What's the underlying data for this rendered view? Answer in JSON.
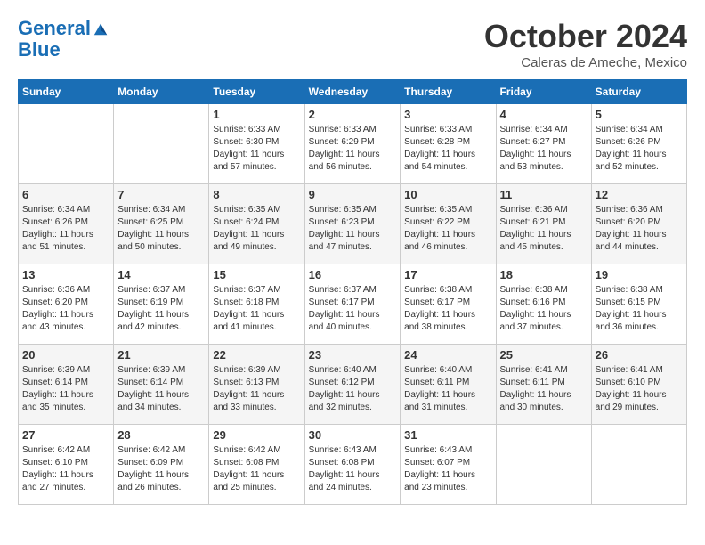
{
  "header": {
    "logo_line1": "General",
    "logo_line2": "Blue",
    "month": "October 2024",
    "location": "Caleras de Ameche, Mexico"
  },
  "days_of_week": [
    "Sunday",
    "Monday",
    "Tuesday",
    "Wednesday",
    "Thursday",
    "Friday",
    "Saturday"
  ],
  "weeks": [
    [
      {
        "day": "",
        "info": ""
      },
      {
        "day": "",
        "info": ""
      },
      {
        "day": "1",
        "info": "Sunrise: 6:33 AM\nSunset: 6:30 PM\nDaylight: 11 hours and 57 minutes."
      },
      {
        "day": "2",
        "info": "Sunrise: 6:33 AM\nSunset: 6:29 PM\nDaylight: 11 hours and 56 minutes."
      },
      {
        "day": "3",
        "info": "Sunrise: 6:33 AM\nSunset: 6:28 PM\nDaylight: 11 hours and 54 minutes."
      },
      {
        "day": "4",
        "info": "Sunrise: 6:34 AM\nSunset: 6:27 PM\nDaylight: 11 hours and 53 minutes."
      },
      {
        "day": "5",
        "info": "Sunrise: 6:34 AM\nSunset: 6:26 PM\nDaylight: 11 hours and 52 minutes."
      }
    ],
    [
      {
        "day": "6",
        "info": "Sunrise: 6:34 AM\nSunset: 6:26 PM\nDaylight: 11 hours and 51 minutes."
      },
      {
        "day": "7",
        "info": "Sunrise: 6:34 AM\nSunset: 6:25 PM\nDaylight: 11 hours and 50 minutes."
      },
      {
        "day": "8",
        "info": "Sunrise: 6:35 AM\nSunset: 6:24 PM\nDaylight: 11 hours and 49 minutes."
      },
      {
        "day": "9",
        "info": "Sunrise: 6:35 AM\nSunset: 6:23 PM\nDaylight: 11 hours and 47 minutes."
      },
      {
        "day": "10",
        "info": "Sunrise: 6:35 AM\nSunset: 6:22 PM\nDaylight: 11 hours and 46 minutes."
      },
      {
        "day": "11",
        "info": "Sunrise: 6:36 AM\nSunset: 6:21 PM\nDaylight: 11 hours and 45 minutes."
      },
      {
        "day": "12",
        "info": "Sunrise: 6:36 AM\nSunset: 6:20 PM\nDaylight: 11 hours and 44 minutes."
      }
    ],
    [
      {
        "day": "13",
        "info": "Sunrise: 6:36 AM\nSunset: 6:20 PM\nDaylight: 11 hours and 43 minutes."
      },
      {
        "day": "14",
        "info": "Sunrise: 6:37 AM\nSunset: 6:19 PM\nDaylight: 11 hours and 42 minutes."
      },
      {
        "day": "15",
        "info": "Sunrise: 6:37 AM\nSunset: 6:18 PM\nDaylight: 11 hours and 41 minutes."
      },
      {
        "day": "16",
        "info": "Sunrise: 6:37 AM\nSunset: 6:17 PM\nDaylight: 11 hours and 40 minutes."
      },
      {
        "day": "17",
        "info": "Sunrise: 6:38 AM\nSunset: 6:17 PM\nDaylight: 11 hours and 38 minutes."
      },
      {
        "day": "18",
        "info": "Sunrise: 6:38 AM\nSunset: 6:16 PM\nDaylight: 11 hours and 37 minutes."
      },
      {
        "day": "19",
        "info": "Sunrise: 6:38 AM\nSunset: 6:15 PM\nDaylight: 11 hours and 36 minutes."
      }
    ],
    [
      {
        "day": "20",
        "info": "Sunrise: 6:39 AM\nSunset: 6:14 PM\nDaylight: 11 hours and 35 minutes."
      },
      {
        "day": "21",
        "info": "Sunrise: 6:39 AM\nSunset: 6:14 PM\nDaylight: 11 hours and 34 minutes."
      },
      {
        "day": "22",
        "info": "Sunrise: 6:39 AM\nSunset: 6:13 PM\nDaylight: 11 hours and 33 minutes."
      },
      {
        "day": "23",
        "info": "Sunrise: 6:40 AM\nSunset: 6:12 PM\nDaylight: 11 hours and 32 minutes."
      },
      {
        "day": "24",
        "info": "Sunrise: 6:40 AM\nSunset: 6:11 PM\nDaylight: 11 hours and 31 minutes."
      },
      {
        "day": "25",
        "info": "Sunrise: 6:41 AM\nSunset: 6:11 PM\nDaylight: 11 hours and 30 minutes."
      },
      {
        "day": "26",
        "info": "Sunrise: 6:41 AM\nSunset: 6:10 PM\nDaylight: 11 hours and 29 minutes."
      }
    ],
    [
      {
        "day": "27",
        "info": "Sunrise: 6:42 AM\nSunset: 6:10 PM\nDaylight: 11 hours and 27 minutes."
      },
      {
        "day": "28",
        "info": "Sunrise: 6:42 AM\nSunset: 6:09 PM\nDaylight: 11 hours and 26 minutes."
      },
      {
        "day": "29",
        "info": "Sunrise: 6:42 AM\nSunset: 6:08 PM\nDaylight: 11 hours and 25 minutes."
      },
      {
        "day": "30",
        "info": "Sunrise: 6:43 AM\nSunset: 6:08 PM\nDaylight: 11 hours and 24 minutes."
      },
      {
        "day": "31",
        "info": "Sunrise: 6:43 AM\nSunset: 6:07 PM\nDaylight: 11 hours and 23 minutes."
      },
      {
        "day": "",
        "info": ""
      },
      {
        "day": "",
        "info": ""
      }
    ]
  ]
}
